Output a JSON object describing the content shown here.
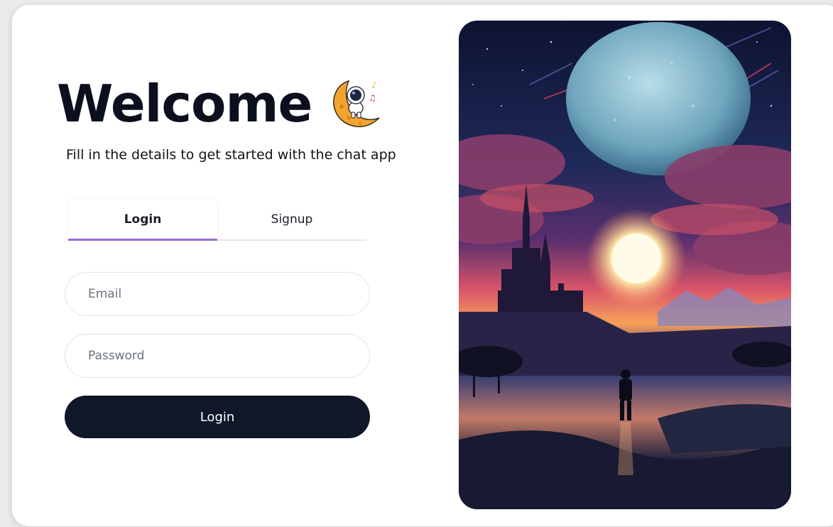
{
  "header": {
    "title": "Welcome",
    "subtitle": "Fill in the details to get started with the chat app",
    "mascot_icon": "astronaut-on-moon-icon"
  },
  "tabs": [
    {
      "label": "Login",
      "active": true
    },
    {
      "label": "Signup",
      "active": false
    }
  ],
  "form": {
    "email_placeholder": "Email",
    "email_value": "",
    "password_placeholder": "Password",
    "password_value": "",
    "submit_label": "Login"
  },
  "colors": {
    "accent": "#9b6cd6",
    "button_bg": "#0f1728",
    "title_color": "#0b0f1e"
  },
  "illustration": {
    "subject": "night-landscape-castle-moon-wanderer-image"
  }
}
